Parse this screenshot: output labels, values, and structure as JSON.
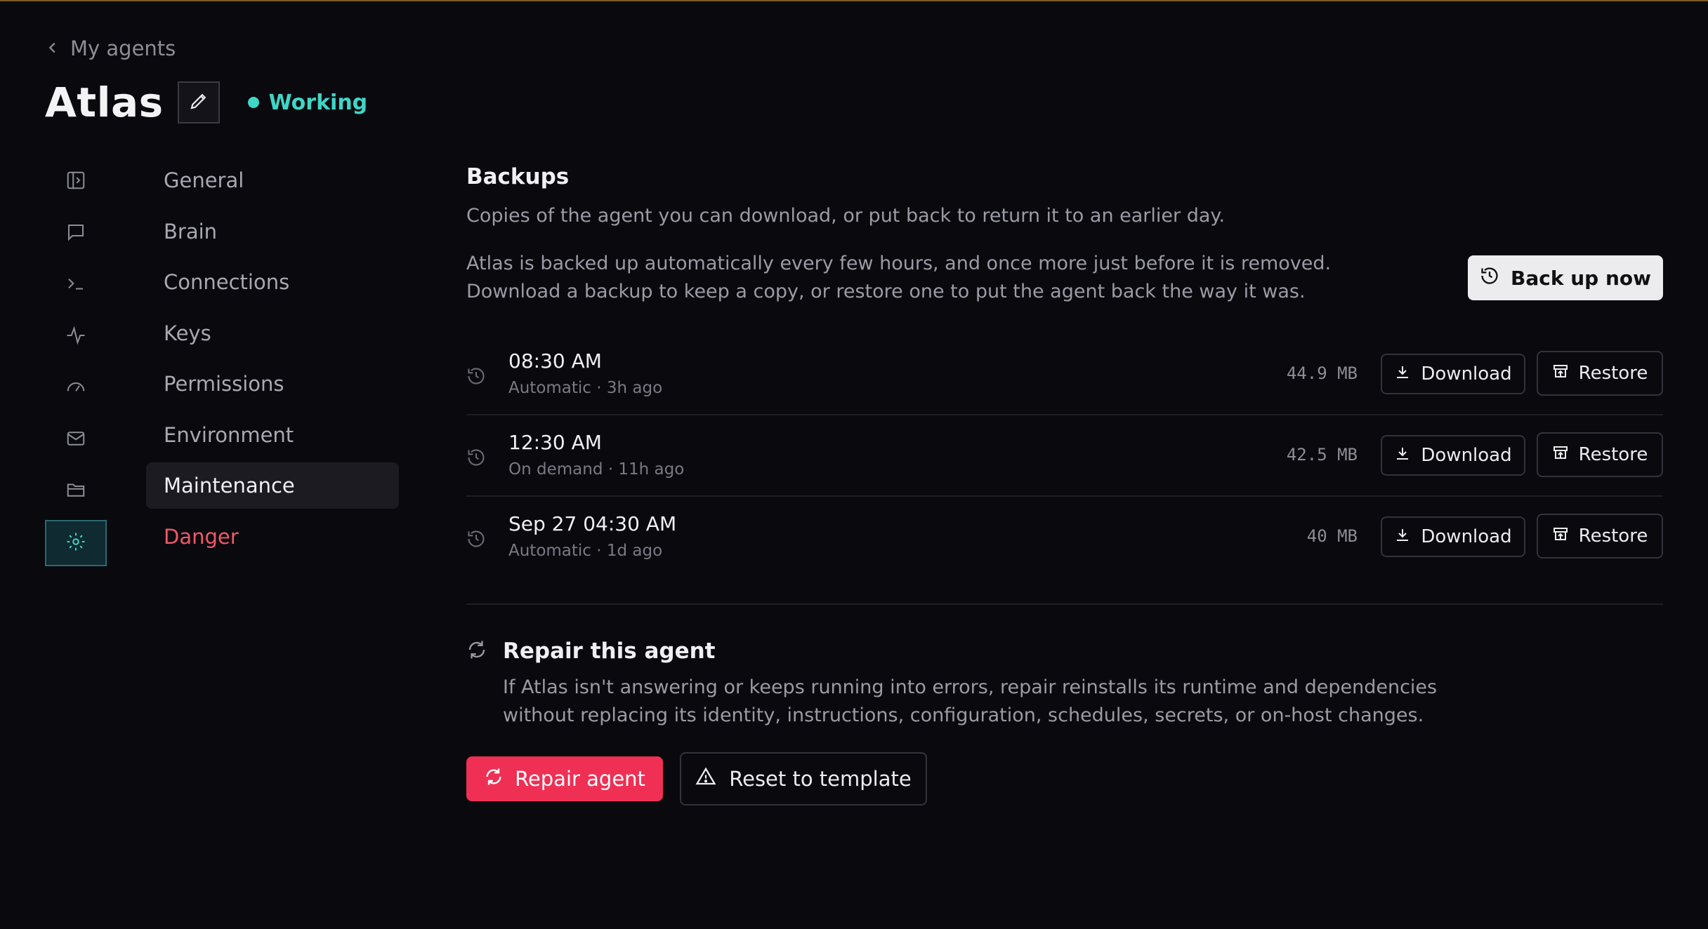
{
  "header": {
    "back_label": "My agents",
    "agent_name": "Atlas",
    "status": "Working"
  },
  "rail": {
    "icons": [
      "panel-icon",
      "chat-icon",
      "terminal-icon",
      "activity-icon",
      "gauge-icon",
      "mail-icon",
      "folder-icon",
      "gear-icon"
    ],
    "active": "gear-icon"
  },
  "nav": {
    "items": [
      {
        "label": "General"
      },
      {
        "label": "Brain"
      },
      {
        "label": "Connections"
      },
      {
        "label": "Keys"
      },
      {
        "label": "Permissions"
      },
      {
        "label": "Environment"
      },
      {
        "label": "Maintenance"
      },
      {
        "label": "Danger"
      }
    ],
    "active": "Maintenance"
  },
  "backups": {
    "title": "Backups",
    "subtitle": "Copies of the agent you can download, or put back to return it to an earlier day.",
    "intro": "Atlas is backed up automatically every few hours, and once more just before it is removed. Download a backup to keep a copy, or restore one to put the agent back the way it was.",
    "backup_now_label": "Back up now",
    "download_label": "Download",
    "restore_label": "Restore",
    "rows": [
      {
        "time": "08:30 AM",
        "meta": "Automatic · 3h ago",
        "size": "44.9 MB"
      },
      {
        "time": "12:30 AM",
        "meta": "On demand · 11h ago",
        "size": "42.5 MB"
      },
      {
        "time": "Sep 27 04:30 AM",
        "meta": "Automatic · 1d ago",
        "size": "40 MB"
      }
    ]
  },
  "repair": {
    "title": "Repair this agent",
    "description": "If Atlas isn't answering or keeps running into errors, repair reinstalls its runtime and dependencies without replacing its identity, instructions, configuration, schedules, secrets, or on-host changes.",
    "repair_label": "Repair agent",
    "reset_label": "Reset to template"
  },
  "colors": {
    "accent_teal": "#3ed6c6",
    "danger": "#ef2f54",
    "background": "#0a090e"
  }
}
